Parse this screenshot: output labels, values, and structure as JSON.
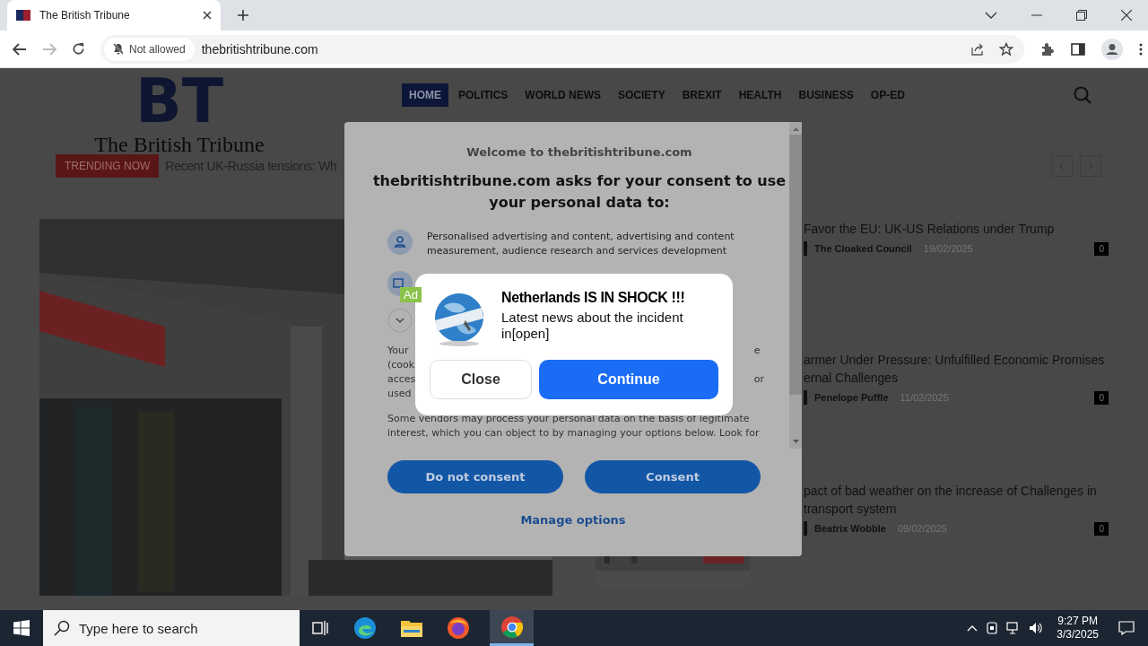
{
  "browser": {
    "tab_title": "The British Tribune",
    "permission_chip": "Not allowed",
    "url": "thebritishtribune.com"
  },
  "site": {
    "logo_letters": "BT",
    "logo_name": "The British Tribune",
    "nav": [
      {
        "label": "HOME",
        "selected": true
      },
      {
        "label": "POLITICS",
        "selected": false
      },
      {
        "label": "WORLD NEWS",
        "selected": false
      },
      {
        "label": "SOCIETY",
        "selected": false
      },
      {
        "label": "BREXIT",
        "selected": false
      },
      {
        "label": "HEALTH",
        "selected": false
      },
      {
        "label": "BUSINESS",
        "selected": false
      },
      {
        "label": "OP-ED",
        "selected": false
      }
    ],
    "trending_label": "TRENDING NOW",
    "trending_text": "Recent UK-Russia tensions: Wh"
  },
  "articles": [
    {
      "title_lines": [
        "Favor the EU: UK-US Relations under Trump"
      ],
      "author": "The Cloaked Council",
      "date": "19/02/2025",
      "comments": "0"
    },
    {
      "title_lines": [
        "armer Under Pressure: Unfulfilled Economic Promises",
        "ernal Challenges"
      ],
      "author": "Penelope Puffle",
      "date": "11/02/2025",
      "comments": "0"
    },
    {
      "title_lines": [
        "pact of bad weather on the increase of Challenges in",
        "transport system"
      ],
      "author": "Beatrix Wobble",
      "date": "09/02/2025",
      "comments": "0"
    }
  ],
  "consent": {
    "welcome": "Welcome to thebritishtribune.com",
    "heading": "thebritishtribune.com asks for your consent to use your personal data to:",
    "purpose": "Personalised advertising and content, advertising and content measurement, audience research and services development",
    "covered_rows": [
      {
        "left": "Your",
        "right": "e"
      },
      {
        "left": "(cook"
      },
      {
        "left": "acces",
        "right": "or"
      },
      {
        "left": "used"
      }
    ],
    "vendors_text": "Some vendors may process your personal data on the basis of legitimate interest, which you can object to by managing your options below. Look for",
    "buttons": [
      "Do not consent",
      "Consent"
    ],
    "manage": "Manage options"
  },
  "ad": {
    "badge": "Ad",
    "title": "Netherlands IS IN SHOCK !!!",
    "text": "Latest news about the incident in[open]",
    "buttons": [
      {
        "label": "Close",
        "kind": "secondary"
      },
      {
        "label": "Continue",
        "kind": "primary"
      }
    ]
  },
  "taskbar": {
    "search_placeholder": "Type here to search",
    "time": "9:27 PM",
    "date": "3/3/2025"
  }
}
